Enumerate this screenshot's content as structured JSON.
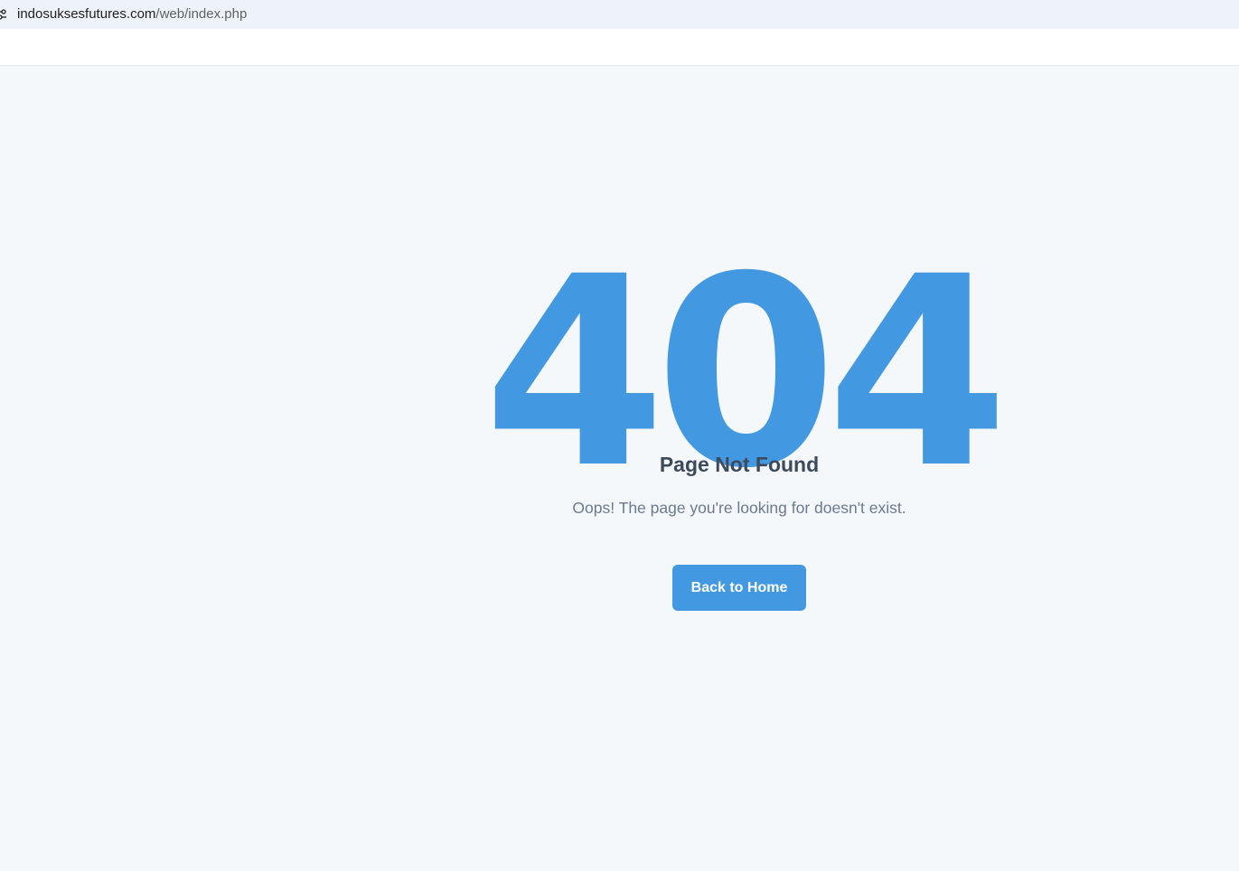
{
  "browser": {
    "url_host": "indosuksesfutures.com",
    "url_path": "/web/index.php",
    "site_info_icon": "site-info-tune-icon"
  },
  "error": {
    "code": "404",
    "title": "Page Not Found",
    "message": "Oops! The page you're looking for doesn't exist.",
    "button_label": "Back to Home"
  },
  "colors": {
    "accent": "#4398e2",
    "background": "#f5f8fb",
    "title_text": "#3c4a5c",
    "message_text": "#6b7a8f",
    "address_bar": "#eef2f9"
  }
}
